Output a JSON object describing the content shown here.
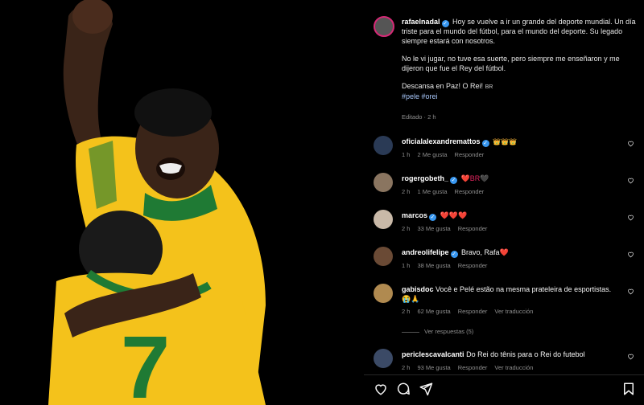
{
  "post": {
    "author": "rafaelnadal",
    "caption_p1": "Hoy se vuelve a ir un grande del deporte mundial. Un día triste para el mundo del fútbol, para el mundo del deporte. Su legado siempre estará con nosotros.",
    "caption_p2": "No le vi jugar, no tuve esa suerte, pero siempre me enseñaron y me dijeron que fue el Rey del fútbol.",
    "caption_p3": "Descansa en Paz! O Rei!",
    "flag_text": "BR",
    "hashtags": "#pele #orei",
    "edited": "Editado · 2 h"
  },
  "comments": [
    {
      "user": "oficialalexandremattos",
      "text": "👑👑👑",
      "time": "1 h",
      "likes": "2 Me gusta",
      "reply": "Responder",
      "translate": ""
    },
    {
      "user": "rogergobeth_",
      "text": "❤️BR🖤",
      "time": "2 h",
      "likes": "1 Me gusta",
      "reply": "Responder",
      "translate": ""
    },
    {
      "user": "marcos",
      "text": "❤️❤️❤️",
      "time": "2 h",
      "likes": "33 Me gusta",
      "reply": "Responder",
      "translate": ""
    },
    {
      "user": "andreolifelipe",
      "text": "Bravo, Rafa❤️",
      "time": "1 h",
      "likes": "38 Me gusta",
      "reply": "Responder",
      "translate": ""
    },
    {
      "user": "gabisdoc",
      "text": "Você e Pelé estão na mesma prateleira de esportistas. 😭🙏",
      "time": "2 h",
      "likes": "62 Me gusta",
      "reply": "Responder",
      "translate": "Ver traducción"
    },
    {
      "user": "periclescavalcanti",
      "text": "Do Rei do tênis para o Rei do futebol",
      "time": "2 h",
      "likes": "93 Me gusta",
      "reply": "Responder",
      "translate": "Ver traducción"
    }
  ],
  "replies_link": "Ver respuestas (5)",
  "icons": [
    "like-icon",
    "comment-icon",
    "share-icon",
    "save-icon",
    "heart-outline-icon",
    "verified-badge-icon"
  ],
  "colors": {
    "verified": "#3897f0",
    "jersey": "#f4c21b",
    "jersey_trim": "#1f7a34",
    "background": "#000000"
  }
}
